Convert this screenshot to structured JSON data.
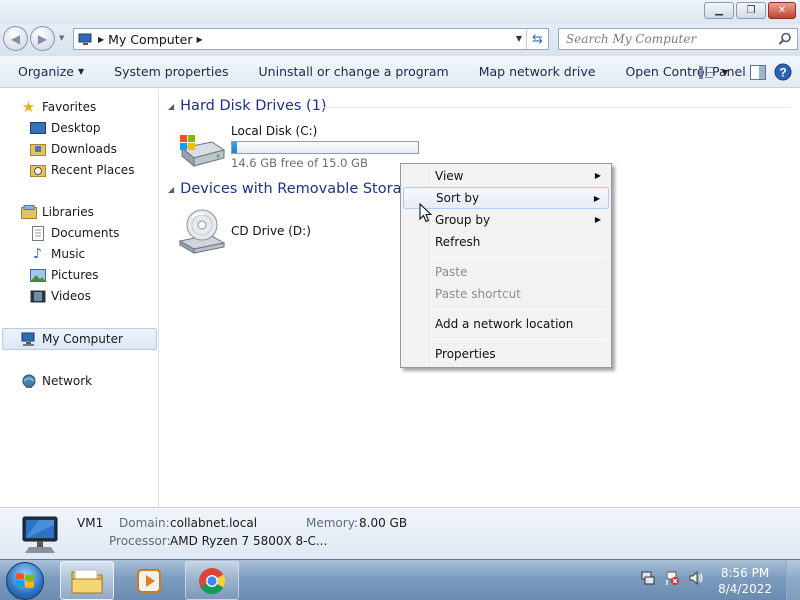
{
  "window": {
    "minimize_glyph": "▁",
    "maximize_glyph": "❐",
    "close_glyph": "✕"
  },
  "address": {
    "location": "My Computer",
    "search_placeholder": "Search My Computer"
  },
  "toolbar": {
    "organize": "Organize",
    "system_properties": "System properties",
    "uninstall": "Uninstall or change a program",
    "map_drive": "Map network drive",
    "control_panel": "Open Control Panel"
  },
  "nav": {
    "favorites": "Favorites",
    "desktop": "Desktop",
    "downloads": "Downloads",
    "recent_places": "Recent Places",
    "libraries": "Libraries",
    "documents": "Documents",
    "music": "Music",
    "pictures": "Pictures",
    "videos": "Videos",
    "my_computer": "My Computer",
    "network": "Network"
  },
  "content": {
    "hdd_header": "Hard Disk Drives (1)",
    "removable_header": "Devices with Removable Storage",
    "local_disk": {
      "name": "Local Disk (C:)",
      "free_text": "14.6 GB free of 15.0 GB",
      "used_fraction": 0.027
    },
    "cd_drive": {
      "name": "CD Drive (D:)"
    }
  },
  "context_menu": {
    "view": "View",
    "sort_by": "Sort by",
    "group_by": "Group by",
    "refresh": "Refresh",
    "paste": "Paste",
    "paste_shortcut": "Paste shortcut",
    "add_network_location": "Add a network location",
    "properties": "Properties"
  },
  "details": {
    "computer_name": "VM1",
    "domain_label": "Domain:",
    "domain_value": "collabnet.local",
    "memory_label": "Memory:",
    "memory_value": "8.00 GB",
    "processor_label": "Processor:",
    "processor_value": "AMD Ryzen 7 5800X 8-C..."
  },
  "taskbar": {
    "time": "8:56 PM",
    "date": "8/4/2022"
  },
  "colors": {
    "header_blue": "#1e3287",
    "highlight_border": "#aecbf0",
    "disk_fill": "#2a8fd6"
  }
}
